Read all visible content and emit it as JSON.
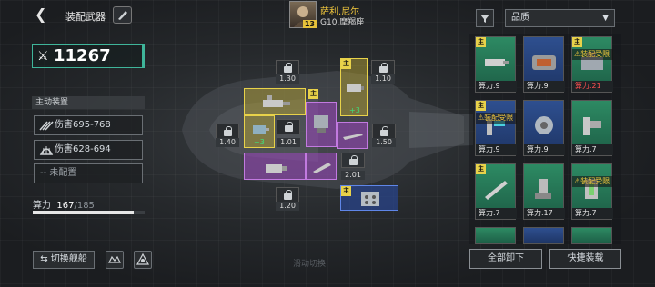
{
  "header": {
    "back_label": "<",
    "title": "装配武器"
  },
  "pilot": {
    "name": "萨利.尼尔",
    "ship": "G10.摩羯座",
    "level": "13"
  },
  "power": {
    "value": "11267"
  },
  "skills": {
    "header": "主动装置",
    "items": [
      {
        "label": "伤害695-768",
        "icon": "claw-icon"
      },
      {
        "label": "伤害628-694",
        "icon": "shell-icon"
      },
      {
        "label": "-- 未配置",
        "icon": ""
      }
    ]
  },
  "calc": {
    "label": "算力",
    "current": "167",
    "sep": "/",
    "max": "185",
    "fraction": 0.903
  },
  "buttons": {
    "switch_ship": "⇆ 切换舰船",
    "unload_all": "全部卸下",
    "quick_equip": "快捷装载"
  },
  "scroll_hint": "滑动切换",
  "slots": {
    "main_badge": "主",
    "plus1": "+3",
    "plus2": "+3",
    "plus3": "+3",
    "lock_vals": [
      "1.30",
      "1.10",
      "1.40",
      "1.01",
      "1.50",
      "2.01",
      "1.20"
    ]
  },
  "filter": {
    "quality_label": "品质",
    "chevron": "▼"
  },
  "cards": [
    {
      "color": "green",
      "power": "算力.9",
      "badge": "主",
      "warn": "",
      "power_red": false
    },
    {
      "color": "blue",
      "power": "算力.9",
      "badge": "",
      "warn": "",
      "power_red": false
    },
    {
      "color": "green",
      "power": "算力.21",
      "badge": "主",
      "warn": "⚠装配受限",
      "power_red": true
    },
    {
      "color": "blue",
      "power": "算力.9",
      "badge": "主",
      "warn": "⚠装配受限",
      "power_red": false
    },
    {
      "color": "blue",
      "power": "算力.9",
      "badge": "",
      "warn": "",
      "power_red": false
    },
    {
      "color": "green",
      "power": "算力.7",
      "badge": "",
      "warn": "",
      "power_red": false
    },
    {
      "color": "green",
      "power": "算力.7",
      "badge": "主",
      "warn": "",
      "power_red": false
    },
    {
      "color": "green",
      "power": "算力.17",
      "badge": "",
      "warn": "",
      "power_red": false
    },
    {
      "color": "green",
      "power": "算力.7",
      "badge": "",
      "warn": "⚠装配受限",
      "power_red": false
    }
  ],
  "colors": {
    "accent": "#3fb59a",
    "main_badge": "#e8d24a",
    "warning": "#ff5050"
  }
}
